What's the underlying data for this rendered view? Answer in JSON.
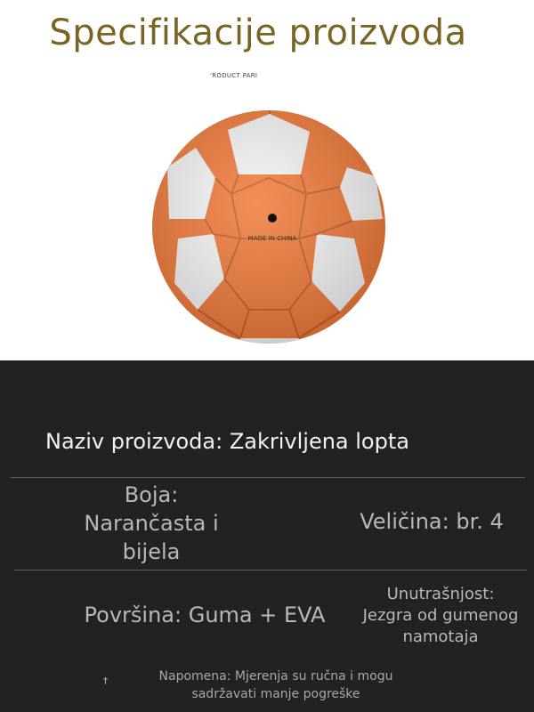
{
  "header": {
    "title": "Specifikacije proizvoda"
  },
  "image": {
    "box_label": "'RODUCT PARI",
    "ball_print": "MADE IN CHINA",
    "colors": {
      "orange": "#f07a3a",
      "white": "#f4f4f4"
    }
  },
  "specs": {
    "name": "Naziv proizvoda: Zakrivljena lopta",
    "color_label": "Boja:",
    "color_value_line1": "Narančasta i",
    "color_value_line2": "bijela",
    "size": "Veličina: br. 4",
    "surface": "Površina: Guma + EVA",
    "core_line1": "Unutrašnjost:",
    "core_line2": "Jezgra od gumenog",
    "core_line3": "namotaja"
  },
  "note": {
    "line1": "Napomena: Mjerenja su ručna i mogu",
    "line2": "sadržavati manje pogreške"
  },
  "mark": "†"
}
